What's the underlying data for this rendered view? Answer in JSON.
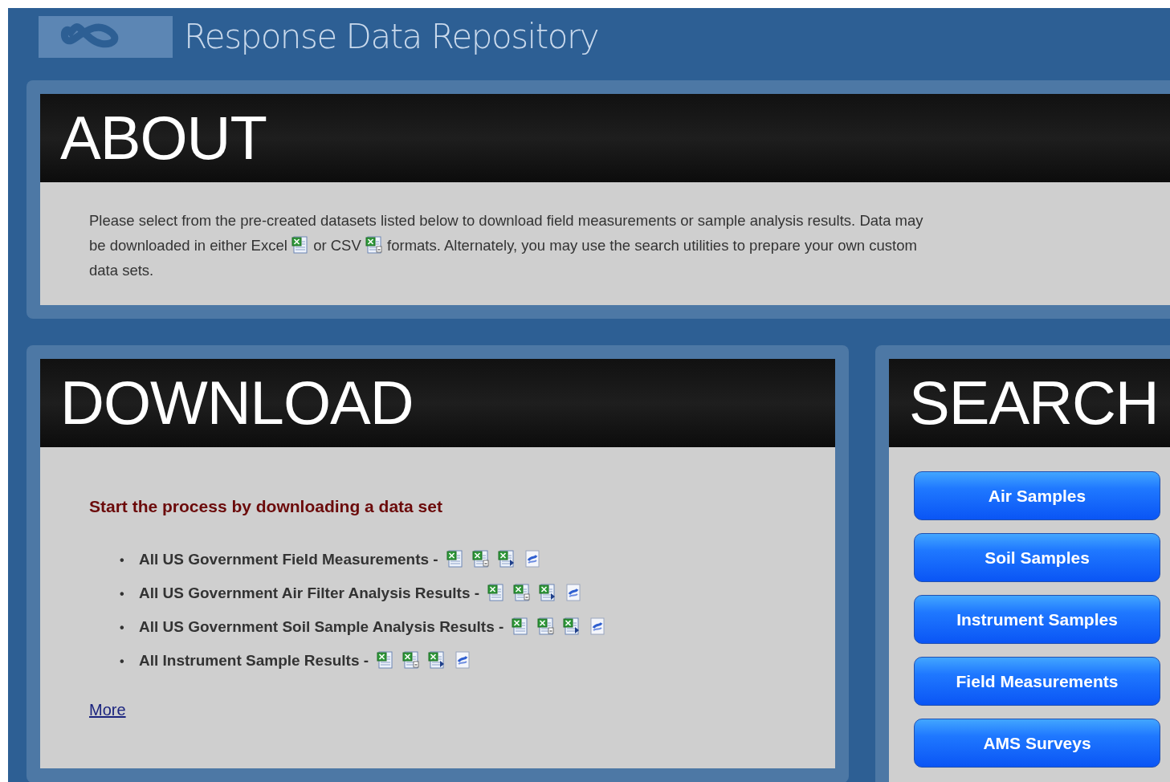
{
  "header": {
    "subtitle": "Response Data Repository"
  },
  "about": {
    "heading": "ABOUT",
    "text_parts": [
      "Please select from the pre-created datasets listed below to download field measurements or sample analysis results. Data may",
      "be downloaded in either Excel",
      "or CSV",
      "formats. Alternately, you may use the search utilities to prepare your own custom",
      "data sets."
    ]
  },
  "download": {
    "heading": "DOWNLOAD",
    "intro": "Start the process by downloading a data set",
    "items": [
      {
        "bullet": "•",
        "label": "All US Government Field Measurements -"
      },
      {
        "bullet": "•",
        "label": "All US Government Air Filter Analysis Results -"
      },
      {
        "bullet": "•",
        "label": "All US Government Soil Sample Analysis Results -"
      },
      {
        "bullet": "•",
        "label": "All Instrument Sample Results -"
      }
    ],
    "more_link": "More"
  },
  "search": {
    "heading": "SEARCH",
    "buttons": [
      "Air Samples",
      "Soil Samples",
      "Instrument Samples",
      "Field Measurements",
      "AMS Surveys"
    ]
  }
}
